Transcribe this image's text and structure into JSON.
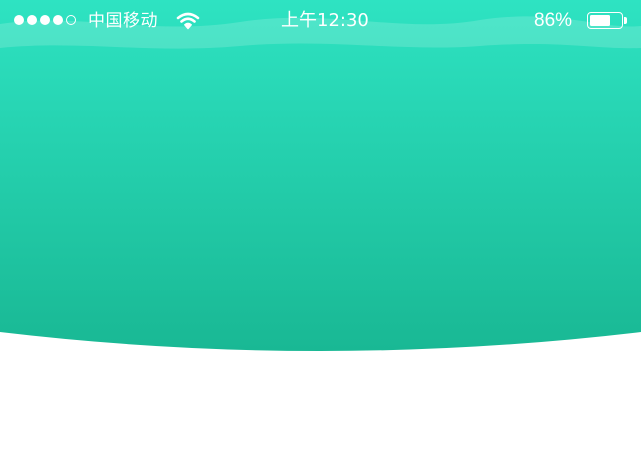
{
  "status_bar": {
    "signal_bars_filled": 4,
    "signal_bars_total": 5,
    "carrier": "中国移动",
    "wifi_icon": "wifi-icon",
    "time": "上午12:30",
    "battery_percent_text": "86%",
    "battery_level": 0.66
  },
  "hero": {
    "gradient_top": "#2ee3c2",
    "gradient_bottom": "#19b894"
  },
  "page_background": "#ffffff"
}
